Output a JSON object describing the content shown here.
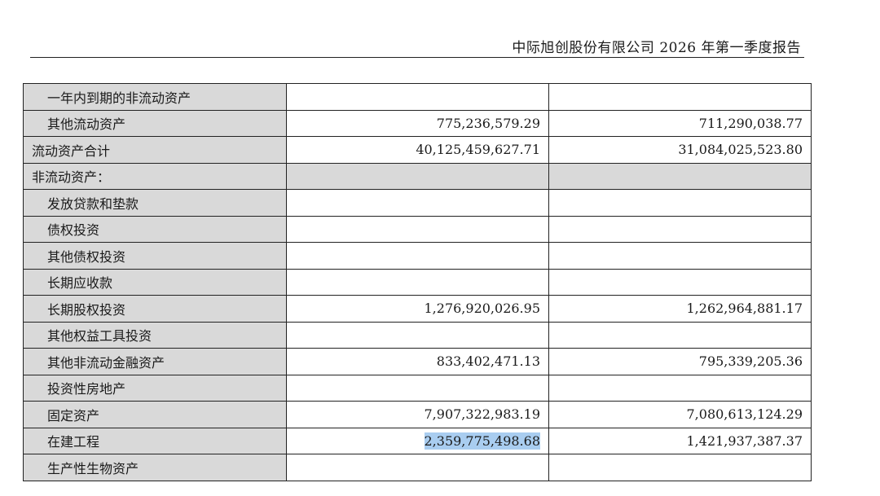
{
  "header": {
    "report_title": "中际旭创股份有限公司 2026 年第一季度报告"
  },
  "table": {
    "rows": [
      {
        "label": "一年内到期的非流动资产",
        "top": false,
        "section": false,
        "v1": "",
        "v2": ""
      },
      {
        "label": "其他流动资产",
        "top": false,
        "section": false,
        "v1": "775,236,579.29",
        "v2": "711,290,038.77"
      },
      {
        "label": "流动资产合计",
        "top": true,
        "section": false,
        "v1": "40,125,459,627.71",
        "v2": "31,084,025,523.80"
      },
      {
        "label": "非流动资产：",
        "top": true,
        "section": true,
        "v1": "",
        "v2": ""
      },
      {
        "label": "发放贷款和垫款",
        "top": false,
        "section": false,
        "v1": "",
        "v2": ""
      },
      {
        "label": "债权投资",
        "top": false,
        "section": false,
        "v1": "",
        "v2": ""
      },
      {
        "label": "其他债权投资",
        "top": false,
        "section": false,
        "v1": "",
        "v2": ""
      },
      {
        "label": "长期应收款",
        "top": false,
        "section": false,
        "v1": "",
        "v2": ""
      },
      {
        "label": "长期股权投资",
        "top": false,
        "section": false,
        "v1": "1,276,920,026.95",
        "v2": "1,262,964,881.17"
      },
      {
        "label": "其他权益工具投资",
        "top": false,
        "section": false,
        "v1": "",
        "v2": ""
      },
      {
        "label": "其他非流动金融资产",
        "top": false,
        "section": false,
        "v1": "833,402,471.13",
        "v2": "795,339,205.36"
      },
      {
        "label": "投资性房地产",
        "top": false,
        "section": false,
        "v1": "",
        "v2": ""
      },
      {
        "label": "固定资产",
        "top": false,
        "section": false,
        "v1": "7,907,322,983.19",
        "v2": "7,080,613,124.29"
      },
      {
        "label": "在建工程",
        "top": false,
        "section": false,
        "v1": "2,359,775,498.68",
        "v2": "1,421,937,387.37",
        "highlight_v1": true
      },
      {
        "label": "生产性生物资产",
        "top": false,
        "section": false,
        "v1": "",
        "v2": ""
      }
    ]
  }
}
